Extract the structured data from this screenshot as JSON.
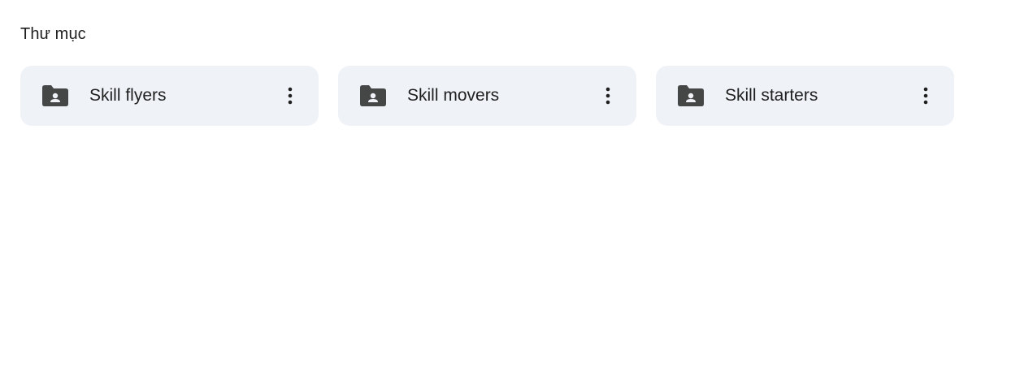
{
  "section": {
    "title": "Thư mục"
  },
  "folders": [
    {
      "name": "Skill flyers",
      "icon": "shared-folder-icon",
      "menu_icon": "more-vert-icon"
    },
    {
      "name": "Skill movers",
      "icon": "shared-folder-icon",
      "menu_icon": "more-vert-icon"
    },
    {
      "name": "Skill starters",
      "icon": "shared-folder-icon",
      "menu_icon": "more-vert-icon"
    }
  ],
  "colors": {
    "card_background": "#eff3f8",
    "icon": "#444746",
    "text": "#1f1f1f",
    "page_background": "#ffffff"
  }
}
